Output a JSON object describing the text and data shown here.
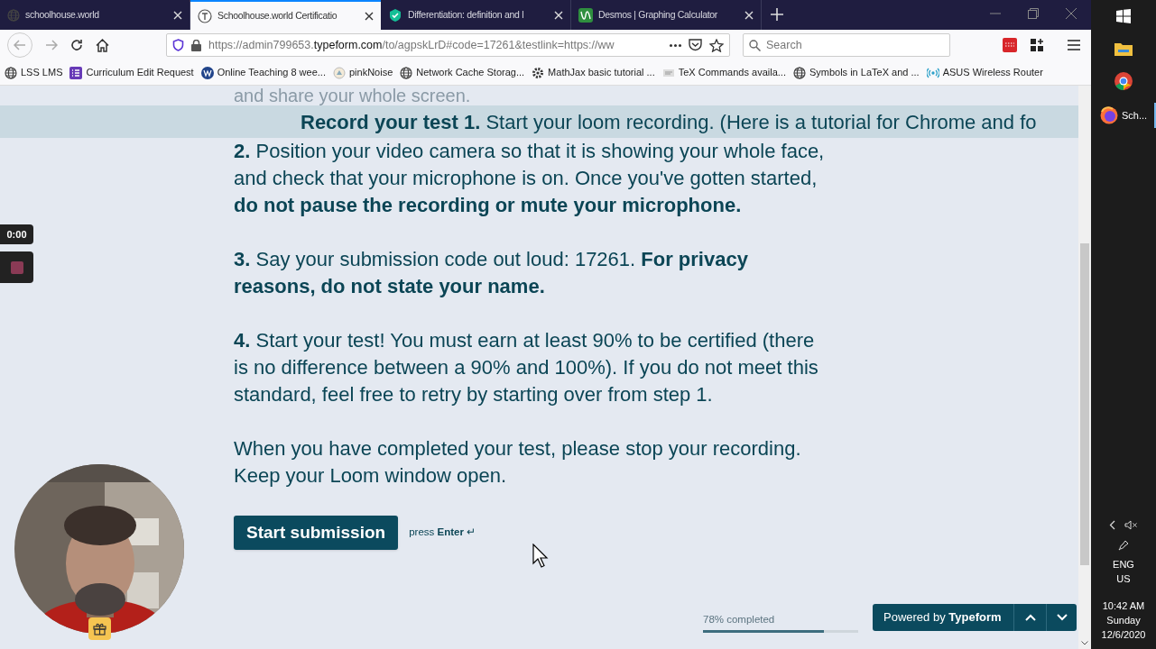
{
  "tabs": [
    {
      "title": "schoolhouse.world",
      "kind": "globe",
      "selected": false
    },
    {
      "title": "Schoolhouse.world Certificatio",
      "kind": "letter",
      "selected": true
    },
    {
      "title": "Differentiation: definition and l",
      "kind": "shield",
      "selected": false
    },
    {
      "title": "Desmos | Graphing Calculator",
      "kind": "graph",
      "selected": false
    }
  ],
  "address_bar": {
    "prefix": "https://admin799653.",
    "domain": "typeform.com",
    "rest": "/to/agpskLrD#code=17261&testlink=https://ww"
  },
  "search": {
    "placeholder": "Search"
  },
  "bookmarks": [
    {
      "label": "LSS LMS",
      "kind": "globe"
    },
    {
      "label": "Curriculum Edit Request",
      "kind": "list"
    },
    {
      "label": "Online Teaching 8 wee...",
      "kind": "wp"
    },
    {
      "label": "pinkNoise",
      "kind": "disc"
    },
    {
      "label": "Network Cache Storag...",
      "kind": "globe"
    },
    {
      "label": "MathJax basic tutorial ...",
      "kind": "gear"
    },
    {
      "label": "TeX Commands availa...",
      "kind": "doc"
    },
    {
      "label": "Symbols in LaTeX and ...",
      "kind": "globe"
    },
    {
      "label": "ASUS Wireless Router",
      "kind": "wifi"
    }
  ],
  "page": {
    "faded_line": "and share your whole screen.",
    "banner": "**Record your test 1.** Start your loom recording. (Here is a tutorial for Chrome and fo",
    "paragraphs": [
      "**2.** Position your video camera so that it is showing your whole face, and check that your microphone is on. Once you've gotten started, **do not pause the recording or mute your microphone.**",
      "**3.** Say your submission code out loud: 17261. **For privacy reasons, do not state your name.**",
      "**4.** Start your test! You must earn at least 90% to be certified (there is no difference between a 90% and 100%). If you do not meet this standard, feel free to retry by starting over from step 1.",
      "When you have completed your test, please stop your recording. Keep your Loom window open."
    ],
    "button": "Start submission",
    "hint": "press **Enter** ↵",
    "progress": {
      "label": "78% completed",
      "level": 0.78
    },
    "powered": "Powered by **Typeform**"
  },
  "recorder": {
    "timer": "0:00"
  },
  "taskbar": {
    "app_label": "Sch...",
    "language": "ENG",
    "region": "US",
    "time": "10:42 AM",
    "day": "Sunday",
    "date": "12/6/2020"
  }
}
